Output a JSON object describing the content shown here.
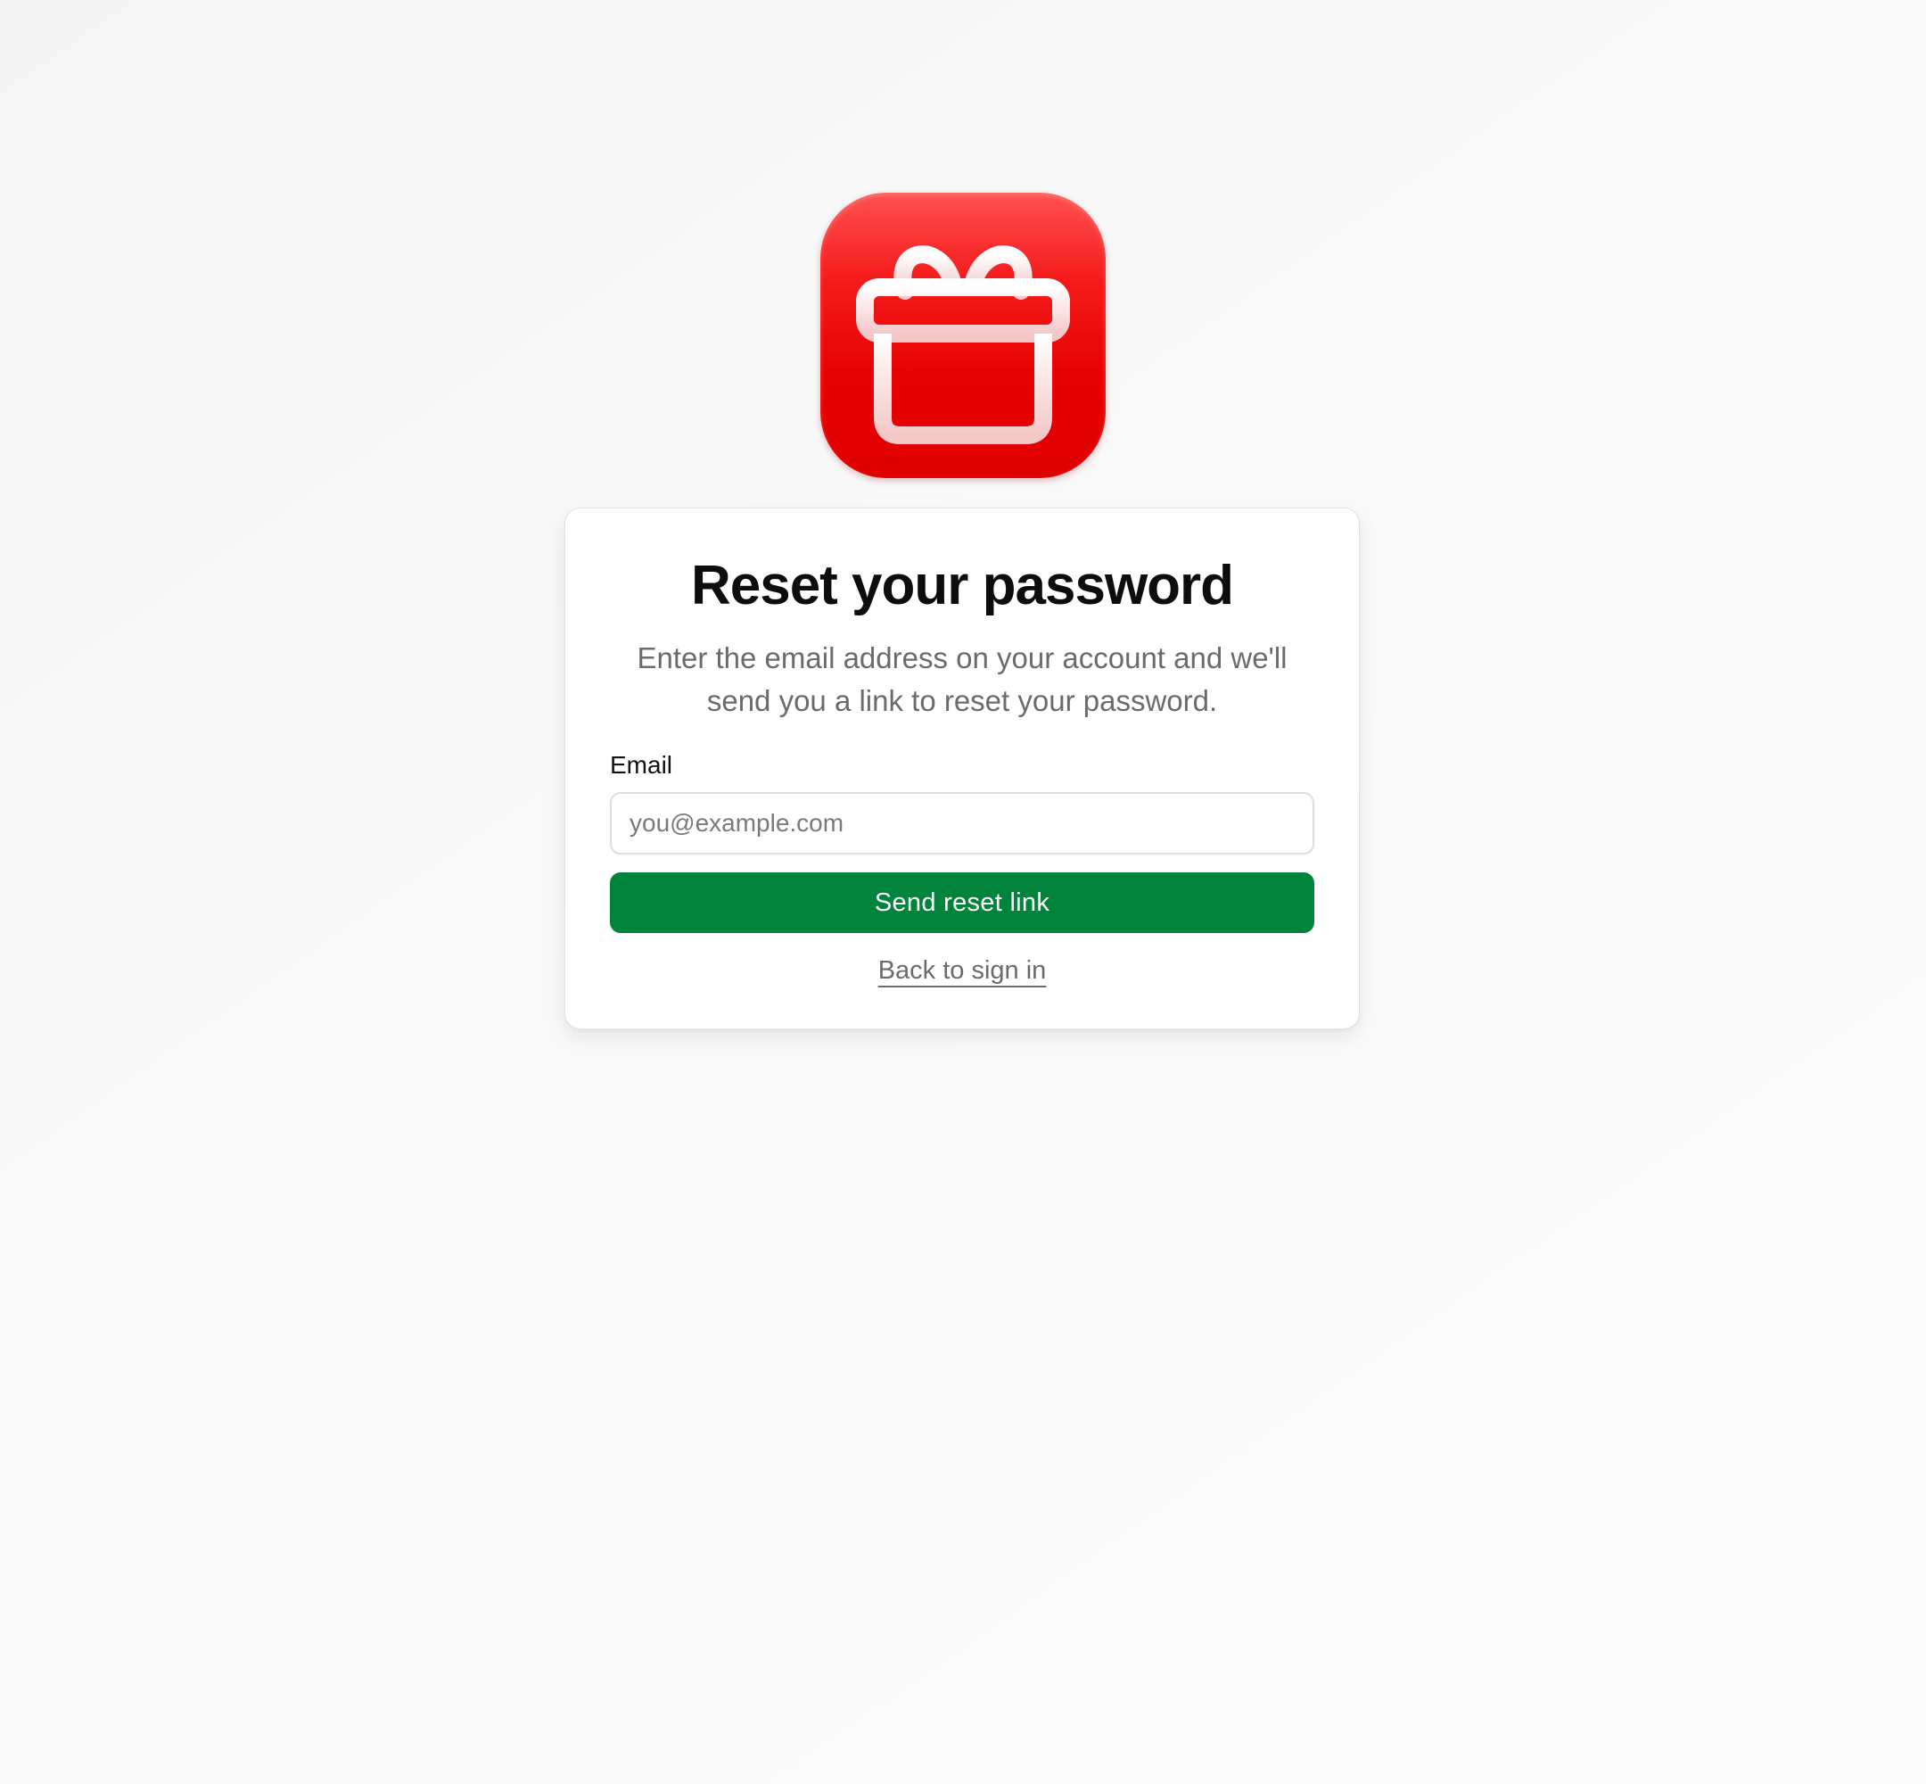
{
  "brand": {
    "icon": "gift-icon",
    "icon_color": "#e60000"
  },
  "card": {
    "title": "Reset your password",
    "subtitle": "Enter the email address on your account and we'll send you a link to reset your password.",
    "email_label": "Email",
    "email_placeholder": "you@example.com",
    "email_value": "",
    "submit_label": "Send reset link",
    "back_link_label": "Back to sign in"
  },
  "colors": {
    "primary_button": "#00833b",
    "background": "#f9f9f9",
    "muted_text": "#6b6b6b"
  }
}
